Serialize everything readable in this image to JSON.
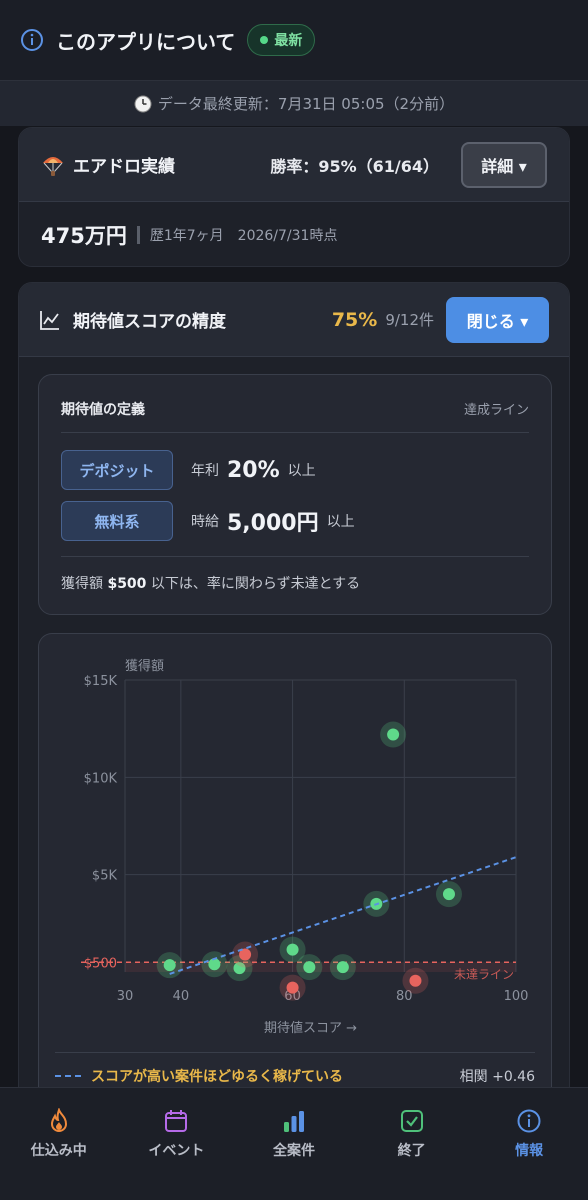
{
  "header": {
    "title": "このアプリについて",
    "badge": "最新",
    "updated": "データ最終更新：7月31日 05:05（2分前）"
  },
  "airdrop": {
    "title": "エアドロ実績",
    "win_rate": "勝率：95%（61/64）",
    "detail_button": "詳細 ▾",
    "amount": "475万円",
    "meta": "歴1年7ヶ月　2026/7/31時点"
  },
  "accuracy": {
    "title": "期待値スコアの精度",
    "percent": "75%",
    "count": "9/12件",
    "close_button": "閉じる ▾",
    "definition": {
      "title": "期待値の定義",
      "hint": "達成ライン",
      "rows": [
        {
          "tag": "デポジット",
          "label": "年利",
          "value": "20%",
          "suffix": "以上"
        },
        {
          "tag": "無料系",
          "label": "時給",
          "value": "5,000円",
          "suffix": "以上"
        }
      ],
      "note_amount": "$500",
      "note_text": "以下は、率に関わらず未達とする",
      "note_prefix": "獲得額"
    },
    "legend": {
      "text": "スコアが高い案件ほどゆるく稼げている",
      "correlation": "相関 +0.46"
    }
  },
  "chart_data": {
    "type": "scatter",
    "ylabel": "獲得額",
    "xlabel": "期待値スコア →",
    "xlim": [
      30,
      100
    ],
    "ylim": [
      0,
      15000
    ],
    "x_ticks": [
      "30",
      "40",
      "60",
      "80",
      "100"
    ],
    "y_ticks": [
      "$15K",
      "$10K",
      "$5K",
      "$500"
    ],
    "threshold": {
      "value": 500,
      "label": "未達ライン"
    },
    "trendline": {
      "from": [
        38,
        -100
      ],
      "to": [
        100,
        5900
      ]
    },
    "colors": {
      "achieved": "#5fd98a",
      "missed": "#e8645e",
      "trend": "#5b92e5"
    },
    "series": [
      {
        "status": "achieved",
        "points": [
          [
            38,
            350
          ],
          [
            46,
            400
          ],
          [
            50.5,
            200
          ],
          [
            60,
            1150
          ],
          [
            63,
            250
          ],
          [
            69,
            250
          ],
          [
            78,
            12200
          ],
          [
            75,
            3500
          ],
          [
            88,
            4000
          ]
        ]
      },
      {
        "status": "missed",
        "points": [
          [
            51.5,
            900
          ],
          [
            60,
            -800
          ],
          [
            82,
            -450
          ]
        ]
      }
    ]
  },
  "tabs": [
    {
      "label": "仕込み中",
      "icon": "flame-icon"
    },
    {
      "label": "イベント",
      "icon": "calendar-icon"
    },
    {
      "label": "全案件",
      "icon": "bar-chart-icon"
    },
    {
      "label": "終了",
      "icon": "check-square-icon"
    },
    {
      "label": "情報",
      "icon": "info-icon",
      "active": true
    }
  ]
}
